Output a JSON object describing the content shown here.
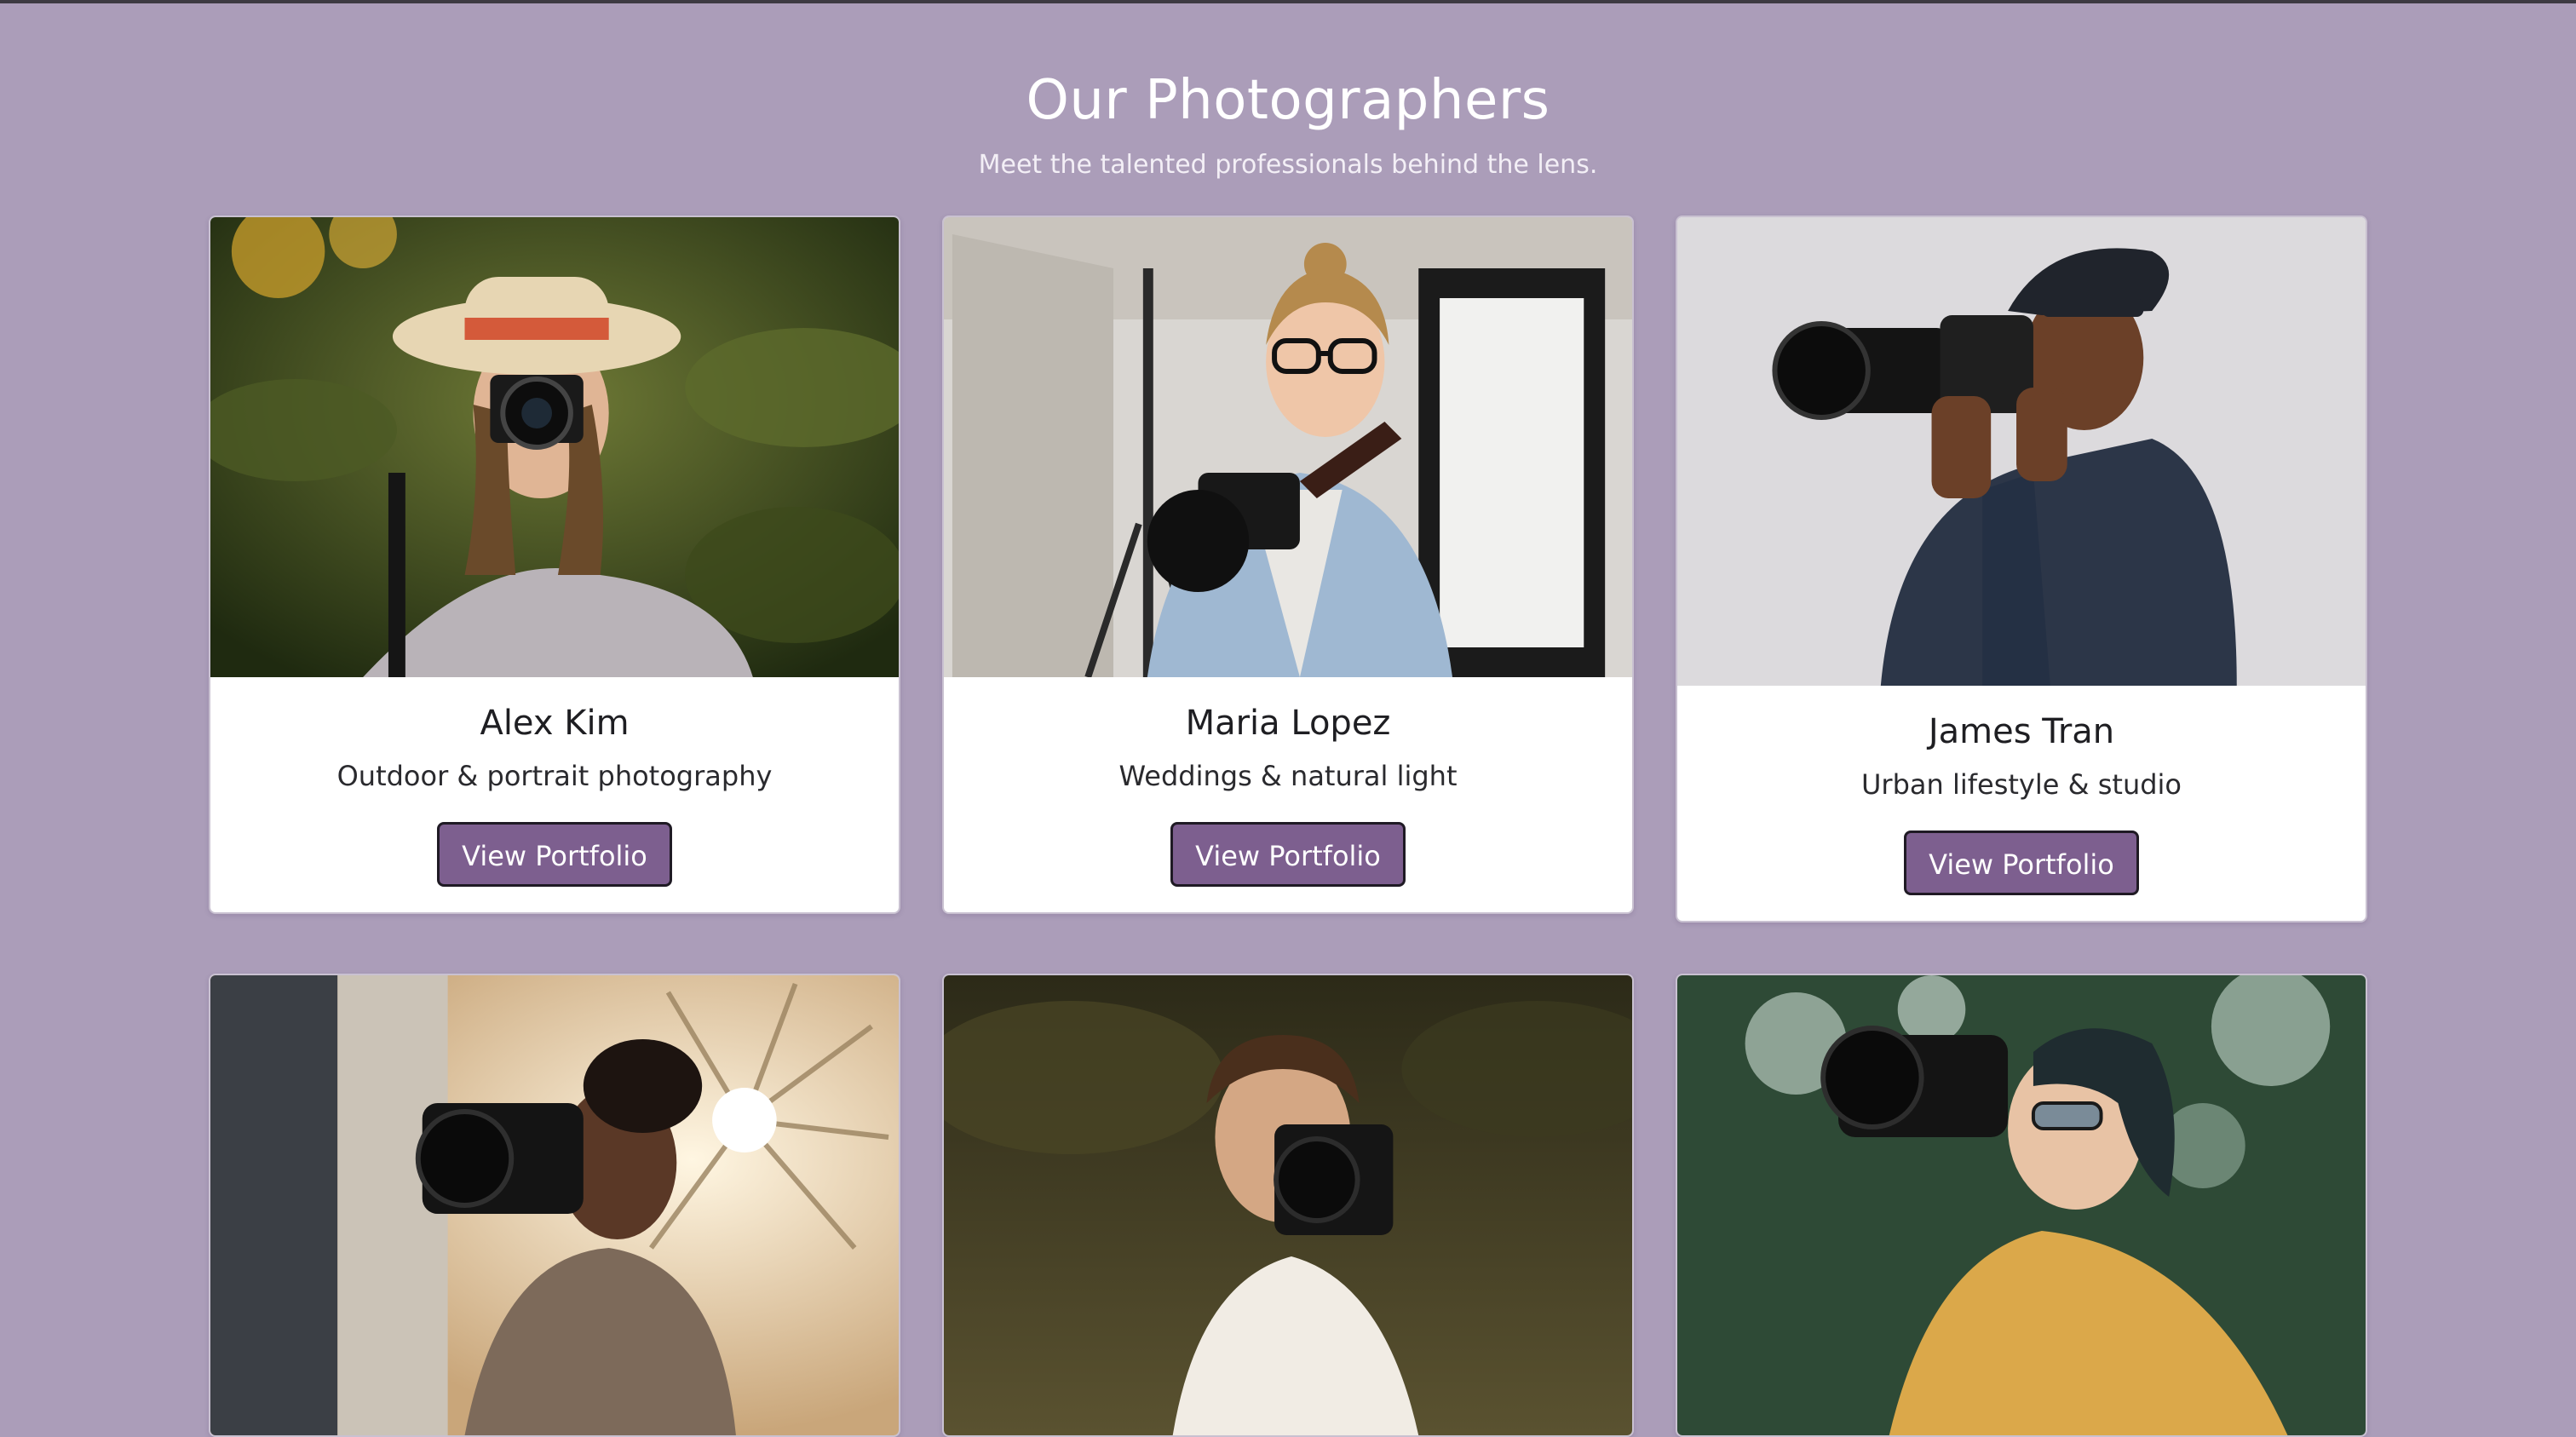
{
  "header": {
    "title": "Our Photographers",
    "subtitle": "Meet the talented professionals behind the lens."
  },
  "photographers": [
    {
      "name": "Alex Kim",
      "specialty": "Outdoor & portrait photography",
      "button": "View Portfolio"
    },
    {
      "name": "Maria Lopez",
      "specialty": "Weddings & natural light",
      "button": "View Portfolio"
    },
    {
      "name": "James Tran",
      "specialty": "Urban lifestyle & studio",
      "button": "View Portfolio"
    }
  ],
  "colors": {
    "background": "#ab9db9",
    "button": "#7d5f8f",
    "card": "#ffffff"
  }
}
